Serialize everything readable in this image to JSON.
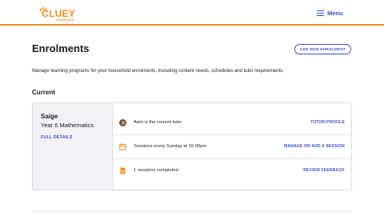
{
  "header": {
    "logo_text": "CLUEY",
    "logo_sub": "LEARNING",
    "menu_label": "Menu"
  },
  "page": {
    "title": "Enrolments",
    "add_button": "ADD NEW ENROLMENT",
    "description": "Manage learning programs for your household enrolments, including content needs, schedules and tutor requirements.",
    "section_title": "Current"
  },
  "enrolment": {
    "student_name": "Saige",
    "course": "Year 6 Mathematics",
    "full_details": "FULL DETAILS",
    "rows": [
      {
        "icon": "tutor-avatar-icon",
        "text": "Aarti is the current tutor",
        "action": "TUTOR PROFILE"
      },
      {
        "icon": "calendar-icon",
        "text": "Sessions every Sunday at 10:00pm",
        "action": "MANAGE OR ADD A SESSION"
      },
      {
        "icon": "document-icon",
        "text": "1 sessions completed",
        "action": "REVIEW FEEDBACK"
      }
    ]
  },
  "colors": {
    "brand_orange": "#f28b1e",
    "link_blue": "#3b4fc4"
  }
}
